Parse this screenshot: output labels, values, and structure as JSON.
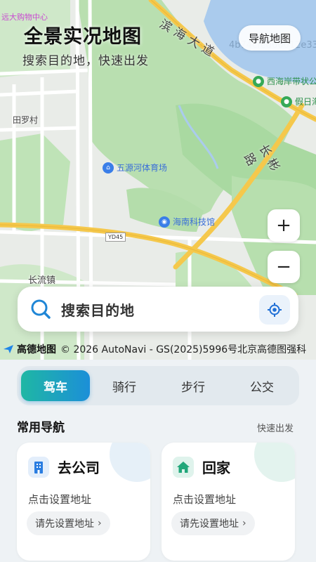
{
  "header": {
    "title": "全景实况地图",
    "subtitle": "搜索目的地，快速出发",
    "corner_text": "远大购物中心",
    "nav_map_button": "导航地图",
    "hash_text": "4b74cfed66012e33"
  },
  "map": {
    "labels": {
      "road_binhai": "滨海大道",
      "road_changbin": "长彬路",
      "village_tianluo": "田罗村",
      "town_changliu": "长流镇",
      "road_shield": "YD45"
    },
    "pois": {
      "stadium": "五源河体育场",
      "museum": "海南科技馆",
      "park_west": "西海岸带状公",
      "park_holiday": "假日海"
    },
    "zoom_in": "+",
    "zoom_out": "−"
  },
  "search": {
    "placeholder": "搜索目的地"
  },
  "attribution": {
    "logo_text": "高德地图",
    "copyright": "© 2026 AutoNavi - GS(2025)5996号北京高德图强科"
  },
  "modes": {
    "tabs": [
      "驾车",
      "骑行",
      "步行",
      "公交"
    ],
    "active": "驾车"
  },
  "quick_nav": {
    "title": "常用导航",
    "link": "快速出发",
    "cards": [
      {
        "title": "去公司",
        "desc": "点击设置地址",
        "button": "请先设置地址",
        "icon": "office-building-icon"
      },
      {
        "title": "回家",
        "desc": "点击设置地址",
        "button": "请先设置地址",
        "icon": "home-icon"
      }
    ]
  },
  "colors": {
    "accent_start": "#1fb7a4",
    "accent_end": "#1c8fd8",
    "poi_blue": "#3a7ee8",
    "poi_green": "#36a957"
  }
}
